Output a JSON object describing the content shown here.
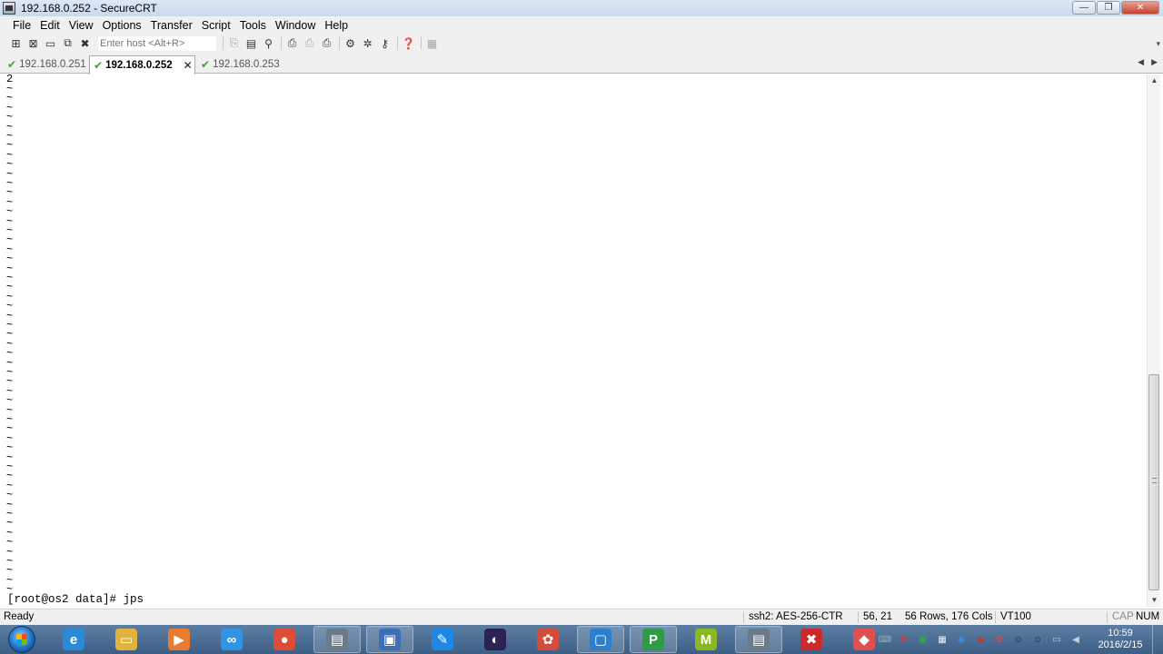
{
  "window": {
    "title": "192.168.0.252 - SecureCRT"
  },
  "window_buttons": {
    "minimize": "—",
    "restore": "❐",
    "close": "✕"
  },
  "menu": [
    "File",
    "Edit",
    "View",
    "Options",
    "Transfer",
    "Script",
    "Tools",
    "Window",
    "Help"
  ],
  "toolbar": {
    "host_placeholder": "Enter host <Alt+R>"
  },
  "tabs": [
    {
      "label": "192.168.0.251",
      "active": false
    },
    {
      "label": "192.168.0.252",
      "active": true
    },
    {
      "label": "192.168.0.253",
      "active": false
    }
  ],
  "terminal": {
    "first_line": "2",
    "tilde": "~",
    "tilde_count": 54,
    "prompt": "[root@os2 data]# jps"
  },
  "status": {
    "ready": "Ready",
    "cipher": "ssh2: AES-256-CTR",
    "cursor": "56,  21",
    "size": "56 Rows, 176 Cols",
    "terminal_type": "VT100",
    "cap": "CAP",
    "num": "NUM"
  },
  "taskbar": {
    "apps": [
      {
        "name": "internet-explorer",
        "glyph": "e",
        "color": "#2a8ad8"
      },
      {
        "name": "file-explorer",
        "glyph": "▭",
        "color": "#e2b33c"
      },
      {
        "name": "media-player",
        "glyph": "▶",
        "color": "#e87b2d"
      },
      {
        "name": "baidu-cloud",
        "glyph": "∞",
        "color": "#2f94e6"
      },
      {
        "name": "chrome",
        "glyph": "●",
        "color": "#dd4b39"
      },
      {
        "name": "securecrt-1",
        "glyph": "▤",
        "color": "#6a7a8a"
      },
      {
        "name": "remote-desktop",
        "glyph": "▣",
        "color": "#3c6fb5"
      },
      {
        "name": "edit-app",
        "glyph": "✎",
        "color": "#1e88e5"
      },
      {
        "name": "eclipse",
        "glyph": "◐",
        "color": "#2c2255"
      },
      {
        "name": "photo-app",
        "glyph": "✿",
        "color": "#d44d3a"
      },
      {
        "name": "virtualbox",
        "glyph": "▢",
        "color": "#2a7fcf"
      },
      {
        "name": "pycharm",
        "glyph": "P",
        "color": "#2e9b45"
      },
      {
        "name": "mendeley",
        "glyph": "M",
        "color": "#8ab820"
      },
      {
        "name": "securecrt-2",
        "glyph": "▤",
        "color": "#6a7a8a"
      },
      {
        "name": "pdf-reader",
        "glyph": "✖",
        "color": "#cc2a2a"
      },
      {
        "name": "eraser-app",
        "glyph": "◆",
        "color": "#e05050"
      }
    ],
    "open_index": [
      5,
      6,
      10,
      11,
      13
    ],
    "tray": [
      "keyboard",
      "red-app",
      "green-app",
      "windows",
      "blue-bird",
      "red-shield",
      "red-cloud",
      "qq",
      "qq-2",
      "network",
      "volume"
    ],
    "time": "10:59",
    "date": "2016/2/15"
  }
}
